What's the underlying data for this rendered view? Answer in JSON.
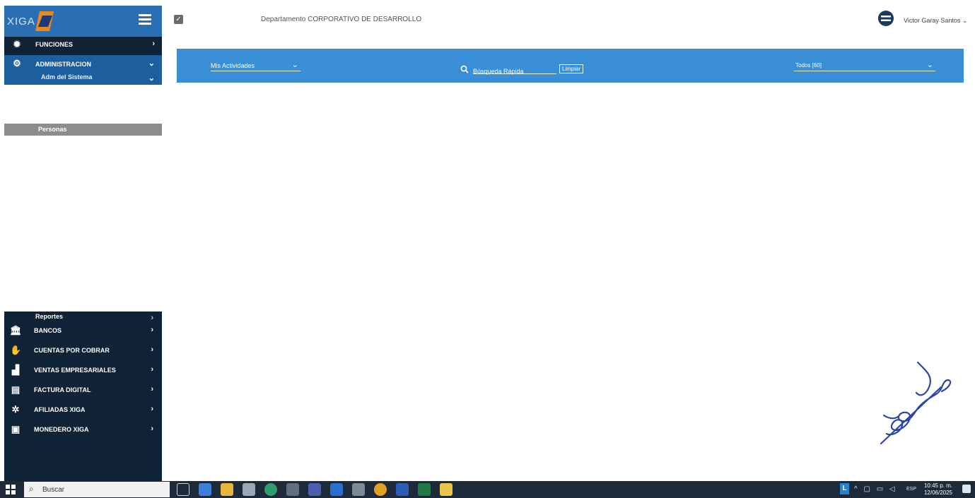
{
  "brand": {
    "logo_text": "XIGA"
  },
  "sidebar": {
    "top_items": [
      {
        "label": "FUNCIONES",
        "icon": "gear-cog-icon"
      },
      {
        "label": "ADMINISTRACION",
        "icon": "settings-icon",
        "sub_label": "Adm del Sistema"
      }
    ],
    "selected_item": "Personas",
    "reportes_label": "Reportes",
    "bottom_items": [
      {
        "label": "BANCOS",
        "icon": "bank-icon"
      },
      {
        "label": "CUENTAS POR COBRAR",
        "icon": "hand-money-icon"
      },
      {
        "label": "VENTAS EMPRESARIALES",
        "icon": "chart-icon"
      },
      {
        "label": "FACTURA DIGITAL",
        "icon": "invoice-icon"
      },
      {
        "label": "AFILIADAS XIGA",
        "icon": "network-icon"
      },
      {
        "label": "MONEDERO XIGA",
        "icon": "wallet-icon"
      }
    ]
  },
  "header": {
    "department": "Departamento CORPORATIVO DE DESARROLLO",
    "user_name": "Victor Garay Santos"
  },
  "action_bar": {
    "activities_select": "Mis Actividades",
    "search_placeholder": "Búsqueda Rápida",
    "clear_label": "Limpiar",
    "filter_select": "Todos [60]"
  },
  "taskbar": {
    "search_label": "Buscar",
    "apps": [
      "task-view-icon",
      "copilot-icon",
      "file-explorer-icon",
      "paint-icon",
      "edge-icon",
      "settings-app-icon",
      "teams-icon",
      "internet-explorer-icon",
      "store-icon",
      "chrome-icon",
      "word-icon",
      "excel-icon",
      "sticky-notes-icon"
    ],
    "lang_indicator": "L",
    "lang": "ESP",
    "time": "10:45 p. m.",
    "date": "12/06/2025"
  },
  "colors": {
    "sidebar_dark": "#0f2236",
    "accent_blue": "#3a8ed6",
    "admin_blue": "#1d5f9e",
    "selected_gray": "#8c8c8c",
    "taskbar": "#1c2a3a"
  }
}
